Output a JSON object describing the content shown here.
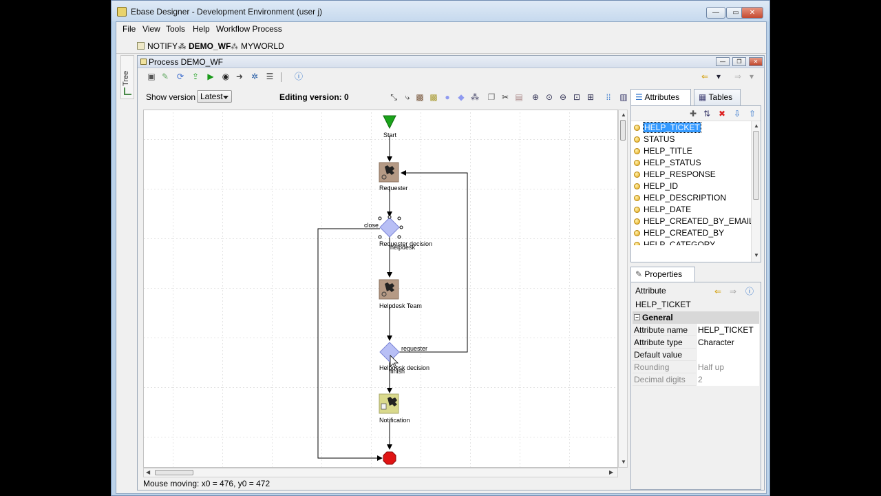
{
  "window": {
    "title": "Ebase Designer - Development Environment (user j)"
  },
  "menu": [
    "File",
    "View",
    "Tools",
    "Help",
    "Workflow Process"
  ],
  "open_tabs": [
    {
      "label": "NOTIFY",
      "bold": false
    },
    {
      "label": "DEMO_WF",
      "bold": true
    },
    {
      "label": "MYWORLD",
      "bold": false
    }
  ],
  "side_strip": {
    "label": "Tree"
  },
  "process_panel": {
    "title": "Process DEMO_WF",
    "show_version_label": "Show version",
    "version_select": "Latest",
    "editing_version": "Editing version: 0"
  },
  "diagram": {
    "nodes": [
      {
        "id": "start",
        "label": "Start",
        "kind": "start"
      },
      {
        "id": "requester",
        "label": "Requester",
        "kind": "task"
      },
      {
        "id": "requester_decision",
        "label": "Requester decision",
        "kind": "decision"
      },
      {
        "id": "helpdesk_team",
        "label": "Helpdesk Team",
        "kind": "task"
      },
      {
        "id": "helpdesk_decision",
        "label": "Helpdesk decision",
        "kind": "decision"
      },
      {
        "id": "notification",
        "label": "Notification",
        "kind": "notify"
      },
      {
        "id": "end",
        "label": "",
        "kind": "end"
      }
    ],
    "edge_labels": {
      "close": "close",
      "helpdesk": "helpdesk",
      "requester": "requester",
      "finish": "finish"
    }
  },
  "status_bar": "Mouse moving: x0 = 476, y0 = 472",
  "attributes_panel": {
    "tabs": [
      "Attributes",
      "Tables"
    ],
    "items": [
      "HELP_TICKET",
      "STATUS",
      "HELP_TITLE",
      "HELP_STATUS",
      "HELP_RESPONSE",
      "HELP_ID",
      "HELP_DESCRIPTION",
      "HELP_DATE",
      "HELP_CREATED_BY_EMAIL",
      "HELP_CREATED_BY",
      "HELP_CATEGORY"
    ],
    "selected": "HELP_TICKET"
  },
  "properties_panel": {
    "tab": "Properties",
    "kind": "Attribute",
    "name": "HELP_TICKET",
    "section": "General",
    "rows": [
      {
        "key": "Attribute name",
        "value": "HELP_TICKET",
        "disabled": false
      },
      {
        "key": "Attribute type",
        "value": "Character",
        "disabled": false
      },
      {
        "key": "Default value",
        "value": "",
        "disabled": false
      },
      {
        "key": "Rounding",
        "value": "Half up",
        "disabled": true
      },
      {
        "key": "Decimal digits",
        "value": "2",
        "disabled": true
      }
    ]
  },
  "colors": {
    "start": "#1aa31a",
    "end": "#e01414",
    "decision": "#b8bff5",
    "task": "#b59a85",
    "notify": "#d9d98c"
  }
}
